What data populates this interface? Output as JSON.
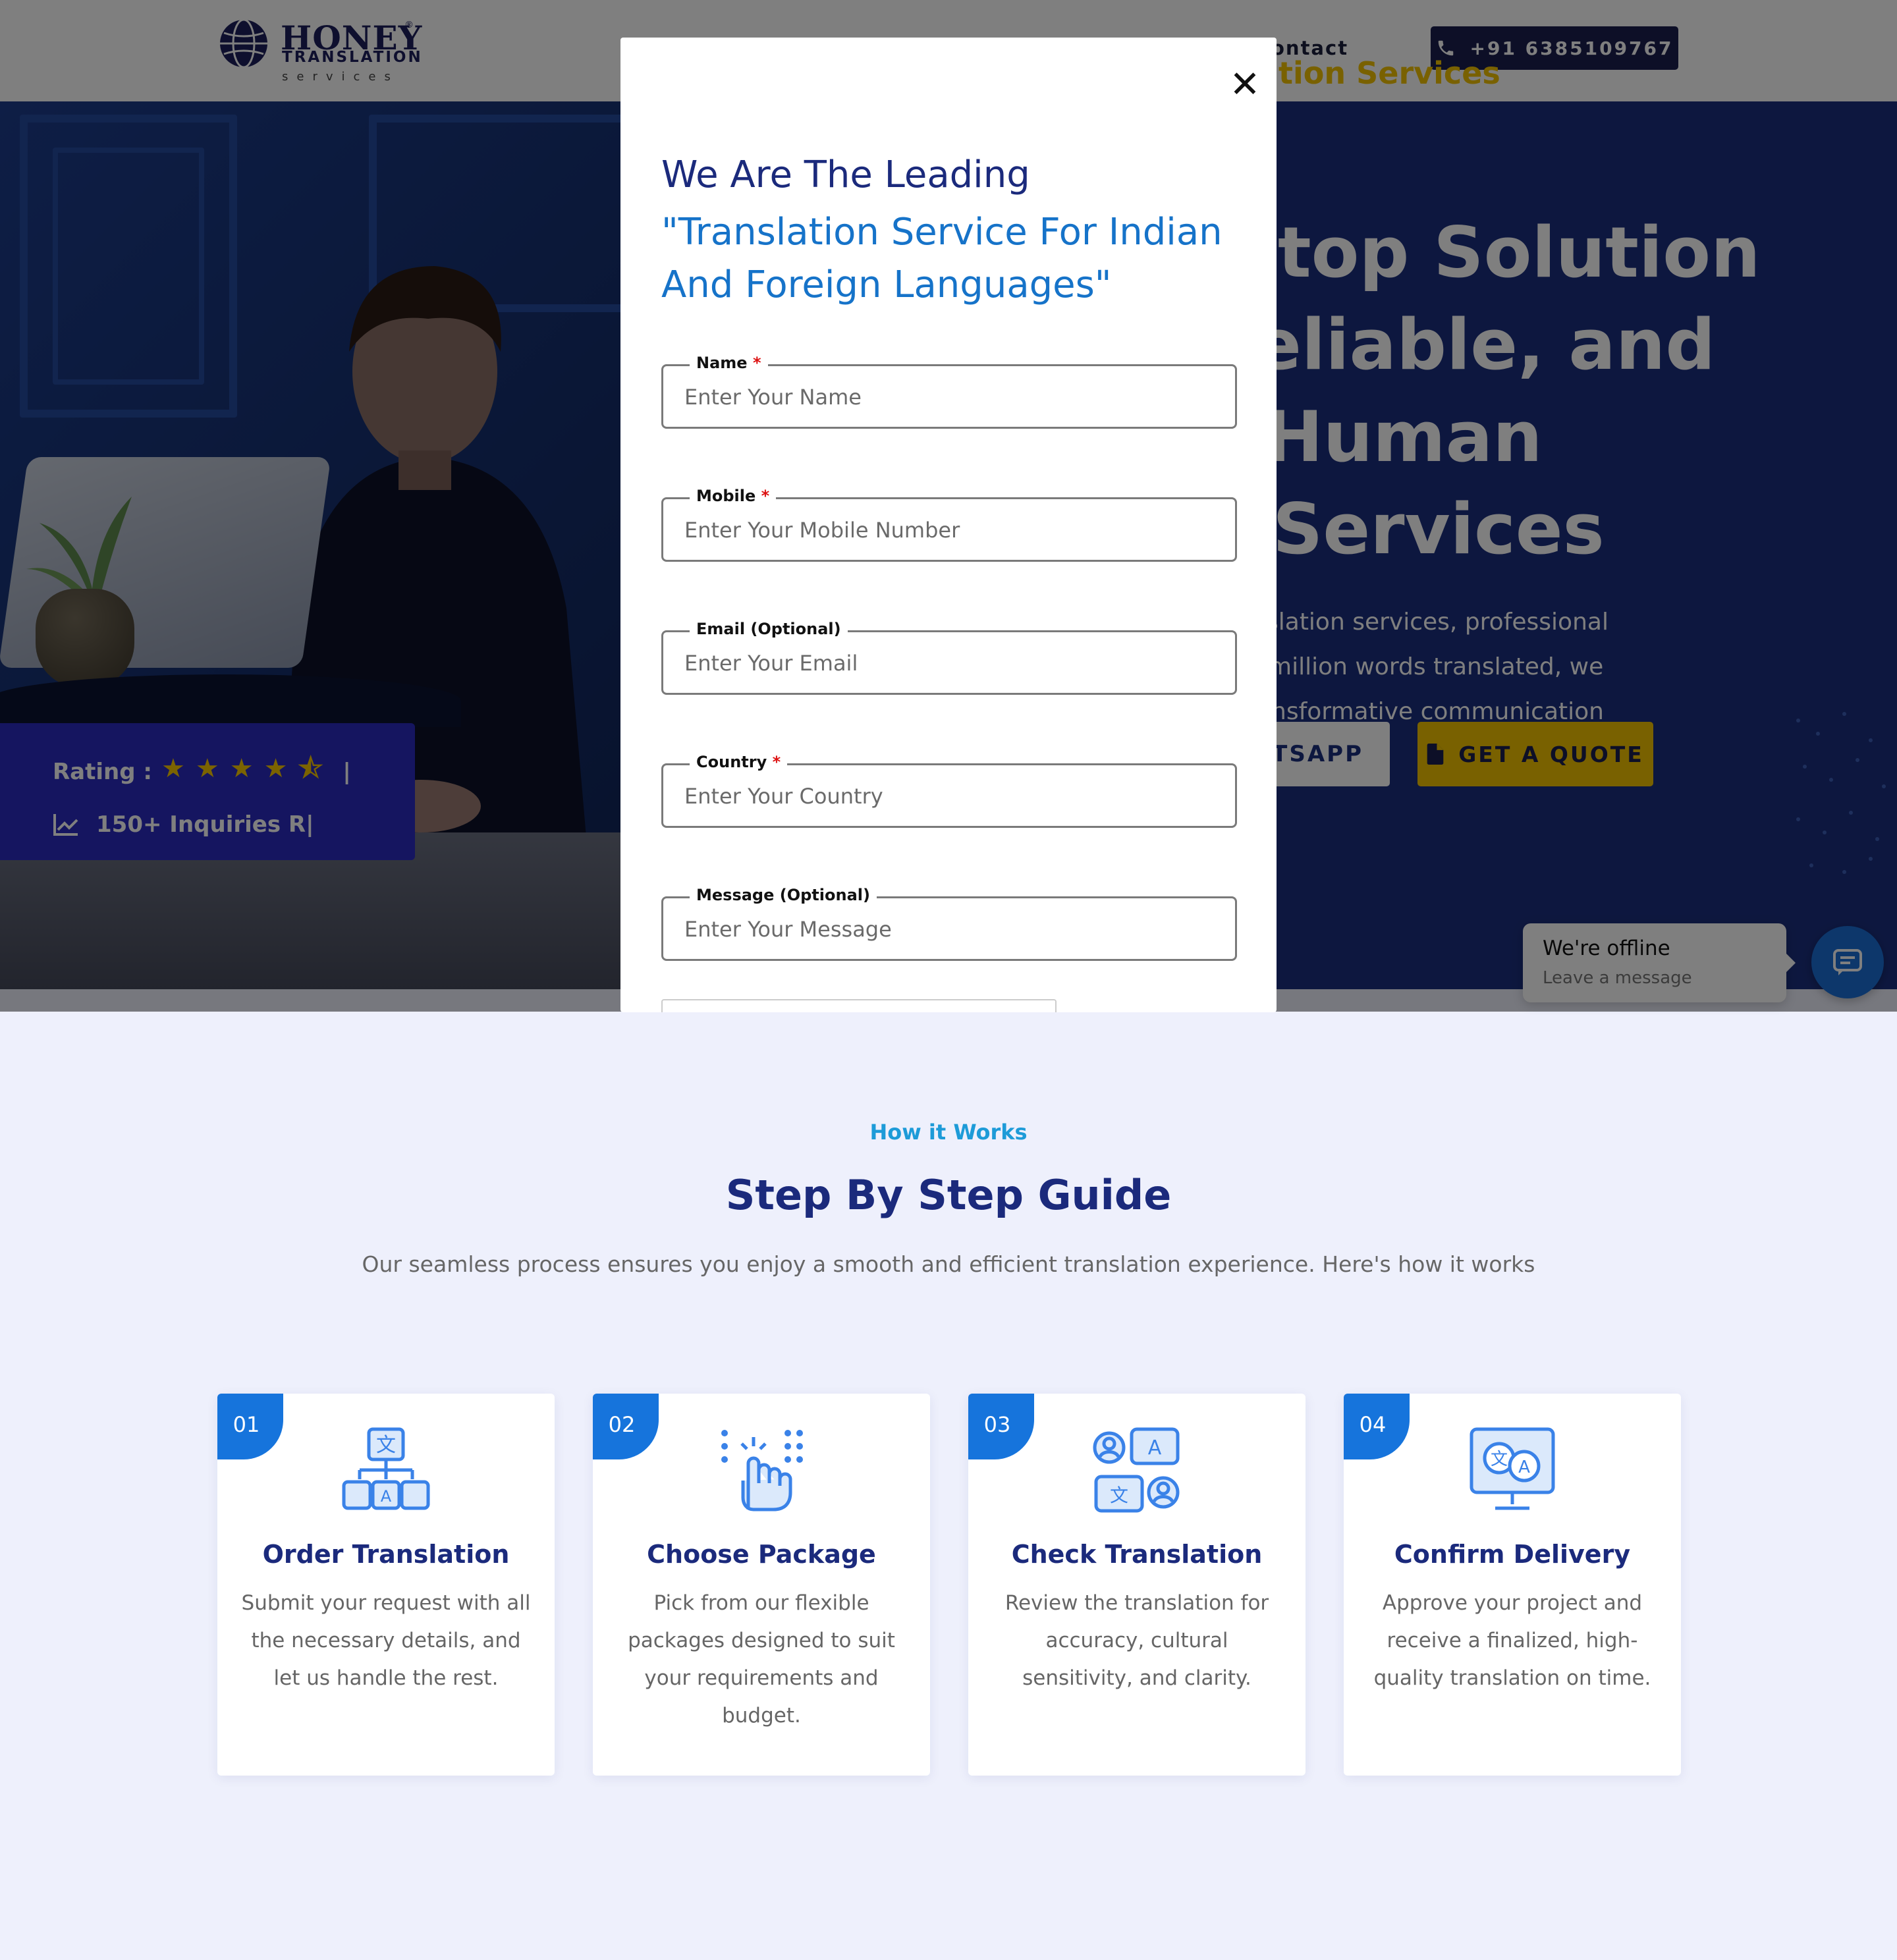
{
  "header": {
    "logo_brand": "HONEY",
    "logo_reg": "®",
    "logo_sub1": "TRANSLATION",
    "logo_sub2": "services",
    "nav_contact": "ontact",
    "phone": "+91 6385109767"
  },
  "hero": {
    "eyebrow": "ation Services",
    "title_lines": [
      "top Solution",
      "eliable, and",
      "Human",
      "Services"
    ],
    "para_lines": [
      "slation services, professional",
      "million words translated, we",
      "nsformative communication"
    ],
    "whatsapp_label": "ATSAPP",
    "quote_label": "GET A QUOTE"
  },
  "rating": {
    "label": "Rating :",
    "stars": "★★★★⯪",
    "separator": "|",
    "inquiries": "150+ Inquiries R|"
  },
  "modal": {
    "close": "✕",
    "heading": "We Are The Leading",
    "subheading": "\"Translation Service For Indian And Foreign Languages\"",
    "fields": [
      {
        "label": "Name",
        "required": "*",
        "placeholder": "Enter Your Name"
      },
      {
        "label": "Mobile",
        "required": "*",
        "placeholder": "Enter Your Mobile Number"
      },
      {
        "label": "Email (Optional)",
        "required": "",
        "placeholder": "Enter Your Email"
      },
      {
        "label": "Country",
        "required": "*",
        "placeholder": "Enter Your Country"
      },
      {
        "label": "Message (Optional)",
        "required": "",
        "placeholder": "Enter Your Message"
      }
    ]
  },
  "how": {
    "eyebrow": "How it Works",
    "title": "Step By Step Guide",
    "subtitle": "Our seamless process ensures you enjoy a smooth and efficient translation experience. Here's how it works",
    "steps": [
      {
        "num": "01",
        "icon": "translate-tree-icon",
        "title": "Order Translation",
        "desc": "Submit your request with all the necessary details, and let us handle the rest."
      },
      {
        "num": "02",
        "icon": "touch-hand-icon",
        "title": "Choose Package",
        "desc": "Pick from our flexible packages designed to suit your requirements and budget."
      },
      {
        "num": "03",
        "icon": "people-translate-icon",
        "title": "Check Translation",
        "desc": "Review the translation for accuracy, cultural sensitivity, and clarity."
      },
      {
        "num": "04",
        "icon": "monitor-translate-icon",
        "title": "Confirm Delivery",
        "desc": "Approve your project and receive a finalized, high-quality translation on time."
      }
    ]
  },
  "chat": {
    "status": "We're offline",
    "prompt": "Leave a message"
  },
  "colors": {
    "navy": "#1b2a7c",
    "accent_blue": "#1674dc",
    "gold": "#f2c200",
    "bg_light": "#eef0fc"
  }
}
